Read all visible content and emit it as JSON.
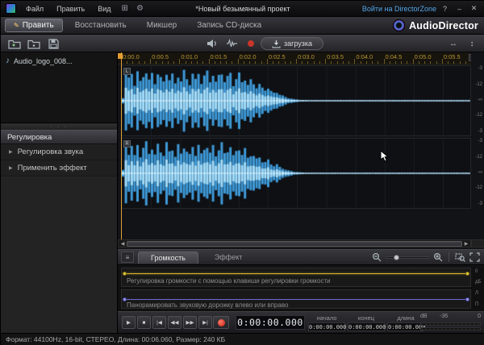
{
  "icons": {
    "gear": "⚙",
    "layout": "⊞",
    "note": "♪",
    "tri": "▶",
    "pencil": "✎",
    "dots": "· · ·",
    "play": "▶",
    "stop": "■",
    "to_start": "|◀",
    "rewind": "◀◀",
    "forward": "▶▶",
    "to_end": "▶|",
    "scroll_left": "◀",
    "scroll_right": "▶",
    "collapse": "≡",
    "fit_h": "↔",
    "fit_v": "↕",
    "help": "?",
    "minimize": "–",
    "close": "✕",
    "vplus": "+",
    "vminus": "−"
  },
  "titlebar": {
    "menus": [
      "Файл",
      "Править",
      "Вид"
    ],
    "title": "*Новый безымянный проект",
    "directorzone": "Войти на DirectorZone"
  },
  "tabs": {
    "edit": "Править",
    "restore": "Восстановить",
    "mixer": "Микшер",
    "cd": "Запись CD-диска",
    "brand": "AudioDirector"
  },
  "toolbar": {
    "download": "загрузка"
  },
  "sidebar": {
    "file": "Audio_logo_008...",
    "panel": "Регулировка",
    "items": [
      "Регулировка звука",
      "Применить эффект"
    ]
  },
  "timeline": {
    "labels": [
      "0:00.0",
      "0:00.5",
      "0:01.0",
      "0:01.5",
      "0:02.0",
      "0:02.5",
      "0:03.0",
      "0:03.5",
      "0:04.0",
      "0:04.5",
      "0:05.0",
      "0:05.5"
    ],
    "channels": [
      "L",
      "R"
    ],
    "db_ticks": [
      "-3",
      "-12",
      "-∞",
      "-12",
      "-3"
    ],
    "bars": 120,
    "envelope": [
      0.1,
      0.95,
      0.7,
      0.88,
      0.55,
      0.92,
      0.6,
      0.8,
      0.97,
      0.65,
      0.85,
      0.58,
      0.9,
      0.72,
      0.6,
      0.95,
      0.68,
      0.82,
      0.55,
      0.88,
      0.62,
      0.93,
      0.7,
      0.58,
      0.85,
      0.66,
      0.9,
      0.6,
      0.78,
      0.92,
      0.64,
      0.86,
      0.58,
      0.8,
      0.95,
      0.62,
      0.75,
      0.88,
      0.55,
      0.7,
      0.85,
      0.6,
      0.76,
      0.5,
      0.65,
      0.55,
      0.45,
      0.52,
      0.4,
      0.35,
      0.42,
      0.3,
      0.25,
      0.28,
      0.2,
      0.16,
      0.12,
      0.09,
      0.07,
      0.05,
      0.04,
      0.03,
      0.025,
      0.02,
      0.015
    ]
  },
  "bottom": {
    "tab_volume": "Громкость",
    "tab_effect": "Эффект"
  },
  "automation": {
    "volume_text": "Регулировка громкости с помощью клавиши регулировки громкости",
    "pan_text": "Панорамировать звуковую дорожку влево или вправо",
    "volume_scale": [
      "0",
      "дБ"
    ],
    "pan_scale": [
      "Л",
      "П"
    ]
  },
  "transport": {
    "time": "0:00:00.000",
    "fields": [
      {
        "label": "начало",
        "value": "0:00:00.000"
      },
      {
        "label": "конец",
        "value": "0:00:00.000"
      },
      {
        "label": "длина",
        "value": "0:00:00.000"
      }
    ],
    "meter_labels": [
      "dB",
      "-36",
      "0"
    ]
  },
  "status": "Формат: 44100Hz, 16-bit, СТЕРЕО, Длина: 00:06.060, Размер: 240 КБ"
}
